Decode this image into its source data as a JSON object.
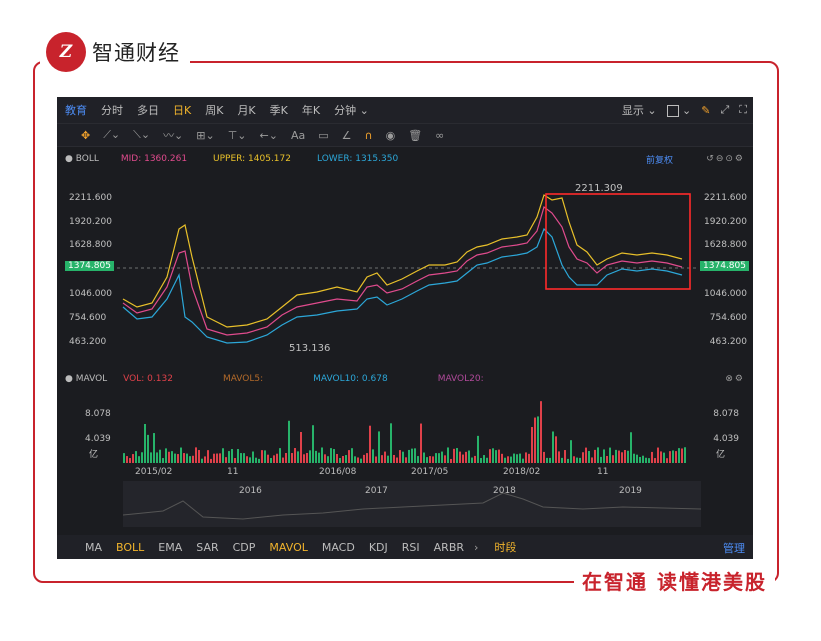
{
  "brand": {
    "logo_text": "Z",
    "name": "智通财经"
  },
  "slogan": "在智通  读懂港美股",
  "toolbar": {
    "items": [
      "教育",
      "分时",
      "多日",
      "日K",
      "周K",
      "月K",
      "季K",
      "年K",
      "分钟"
    ],
    "right": {
      "display_label": "显示"
    }
  },
  "tools2": {
    "text_tool": "Aa"
  },
  "boll": {
    "name": "BOLL",
    "mid": "MID: 1360.261",
    "upper": "UPPER: 1405.172",
    "lower": "LOWER: 1315.350",
    "adjust": "前复权"
  },
  "price_axis": {
    "ticks": [
      "2211.600",
      "1920.200",
      "1628.800",
      "1046.000",
      "754.600",
      "463.200"
    ],
    "current": "1374.805",
    "high_label": "2211.309",
    "low_label": "513.136"
  },
  "volume": {
    "name": "MAVOL",
    "vol": "VOL: 0.132",
    "mavol5": "MAVOL5:",
    "mavol10": "MAVOL10: 0.678",
    "mavol20": "MAVOL20:",
    "ticks": [
      "8.078",
      "4.039",
      "亿"
    ]
  },
  "date_axis": [
    "2015/02",
    "11",
    "2016/08",
    "2017/05",
    "2018/02",
    "11"
  ],
  "navigator_years": [
    "2016",
    "2017",
    "2018",
    "2019"
  ],
  "bottom_tabs": [
    "MA",
    "BOLL",
    "EMA",
    "SAR",
    "CDP",
    "MAVOL",
    "MACD",
    "KDJ",
    "RSI",
    "ARBR",
    "时段"
  ],
  "manage_label": "管理",
  "colors": {
    "frame_red": "#c8232c",
    "upper": "#e8c02a",
    "mid": "#e04b8d",
    "lower": "#2ca7d8",
    "up": "#e0414a",
    "down": "#27b36a"
  }
}
